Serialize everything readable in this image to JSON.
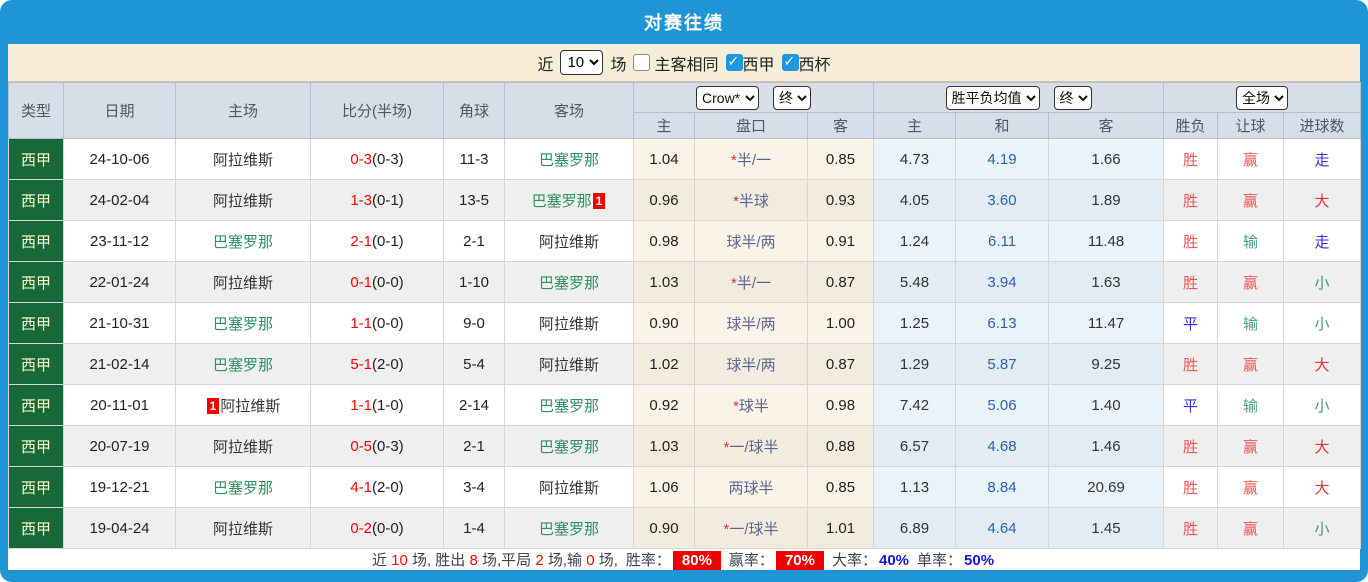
{
  "title": "对赛往绩",
  "filter_bar": {
    "recent_label": "近",
    "recent_select_value": "10",
    "matches_label": "场",
    "checkboxes": [
      {
        "label": "主客相同",
        "checked": false
      },
      {
        "label": "西甲",
        "checked": true
      },
      {
        "label": "西杯",
        "checked": true
      }
    ]
  },
  "table": {
    "base_headers": [
      "类型",
      "日期",
      "主场",
      "比分(半场)",
      "角球",
      "客场"
    ],
    "odds_group": {
      "bookmaker_select": "Crow*",
      "time_select": "终",
      "headers": [
        "主",
        "盘口",
        "客"
      ]
    },
    "avg_group": {
      "type_select": "胜平负均值",
      "time_select": "终",
      "headers": [
        "主",
        "和",
        "客"
      ]
    },
    "result_group": {
      "scope_select": "全场",
      "headers": [
        "胜负",
        "让球",
        "进球数"
      ]
    },
    "rows": [
      {
        "league": "西甲",
        "date": "24-10-06",
        "home": "阿拉维斯",
        "home_green": false,
        "home_badge": "",
        "score": "0-3",
        "half": "(0-3)",
        "corners": "11-3",
        "away": "巴塞罗那",
        "away_green": true,
        "away_badge": "",
        "odds": [
          "1.04",
          "*半/一",
          "0.85"
        ],
        "avg": [
          "4.73",
          "4.19",
          "1.66"
        ],
        "results": [
          [
            "胜",
            "red"
          ],
          [
            "赢",
            "red"
          ],
          [
            "走",
            "blue"
          ]
        ]
      },
      {
        "league": "西甲",
        "date": "24-02-04",
        "home": "阿拉维斯",
        "home_green": false,
        "home_badge": "",
        "score": "1-3",
        "half": "(0-1)",
        "corners": "13-5",
        "away": "巴塞罗那",
        "away_green": true,
        "away_badge": "1",
        "odds": [
          "0.96",
          "*半球",
          "0.93"
        ],
        "avg": [
          "4.05",
          "3.60",
          "1.89"
        ],
        "results": [
          [
            "胜",
            "red"
          ],
          [
            "赢",
            "red"
          ],
          [
            "大",
            "dark_red"
          ]
        ]
      },
      {
        "league": "西甲",
        "date": "23-11-12",
        "home": "巴塞罗那",
        "home_green": true,
        "home_badge": "",
        "score": "2-1",
        "half": "(0-1)",
        "corners": "2-1",
        "away": "阿拉维斯",
        "away_green": false,
        "away_badge": "",
        "odds": [
          "0.98",
          "球半/两",
          "0.91"
        ],
        "avg": [
          "1.24",
          "6.11",
          "11.48"
        ],
        "results": [
          [
            "胜",
            "red"
          ],
          [
            "输",
            "teal"
          ],
          [
            "走",
            "blue"
          ]
        ]
      },
      {
        "league": "西甲",
        "date": "22-01-24",
        "home": "阿拉维斯",
        "home_green": false,
        "home_badge": "",
        "score": "0-1",
        "half": "(0-0)",
        "corners": "1-10",
        "away": "巴塞罗那",
        "away_green": true,
        "away_badge": "",
        "odds": [
          "1.03",
          "*半/一",
          "0.87"
        ],
        "avg": [
          "5.48",
          "3.94",
          "1.63"
        ],
        "results": [
          [
            "胜",
            "red"
          ],
          [
            "赢",
            "red"
          ],
          [
            "小",
            "green"
          ]
        ]
      },
      {
        "league": "西甲",
        "date": "21-10-31",
        "home": "巴塞罗那",
        "home_green": true,
        "home_badge": "",
        "score": "1-1",
        "half": "(0-0)",
        "corners": "9-0",
        "away": "阿拉维斯",
        "away_green": false,
        "away_badge": "",
        "odds": [
          "0.90",
          "球半/两",
          "1.00"
        ],
        "avg": [
          "1.25",
          "6.13",
          "11.47"
        ],
        "results": [
          [
            "平",
            "blue"
          ],
          [
            "输",
            "teal"
          ],
          [
            "小",
            "green"
          ]
        ]
      },
      {
        "league": "西甲",
        "date": "21-02-14",
        "home": "巴塞罗那",
        "home_green": true,
        "home_badge": "",
        "score": "5-1",
        "half": "(2-0)",
        "corners": "5-4",
        "away": "阿拉维斯",
        "away_green": false,
        "away_badge": "",
        "odds": [
          "1.02",
          "球半/两",
          "0.87"
        ],
        "avg": [
          "1.29",
          "5.87",
          "9.25"
        ],
        "results": [
          [
            "胜",
            "red"
          ],
          [
            "赢",
            "red"
          ],
          [
            "大",
            "dark_red"
          ]
        ]
      },
      {
        "league": "西甲",
        "date": "20-11-01",
        "home": "阿拉维斯",
        "home_green": false,
        "home_badge": "1",
        "score": "1-1",
        "half": "(1-0)",
        "corners": "2-14",
        "away": "巴塞罗那",
        "away_green": true,
        "away_badge": "",
        "odds": [
          "0.92",
          "*球半",
          "0.98"
        ],
        "avg": [
          "7.42",
          "5.06",
          "1.40"
        ],
        "results": [
          [
            "平",
            "blue"
          ],
          [
            "输",
            "teal"
          ],
          [
            "小",
            "green"
          ]
        ]
      },
      {
        "league": "西甲",
        "date": "20-07-19",
        "home": "阿拉维斯",
        "home_green": false,
        "home_badge": "",
        "score": "0-5",
        "half": "(0-3)",
        "corners": "2-1",
        "away": "巴塞罗那",
        "away_green": true,
        "away_badge": "",
        "odds": [
          "1.03",
          "*一/球半",
          "0.88"
        ],
        "avg": [
          "6.57",
          "4.68",
          "1.46"
        ],
        "results": [
          [
            "胜",
            "red"
          ],
          [
            "赢",
            "red"
          ],
          [
            "大",
            "dark_red"
          ]
        ]
      },
      {
        "league": "西甲",
        "date": "19-12-21",
        "home": "巴塞罗那",
        "home_green": true,
        "home_badge": "",
        "score": "4-1",
        "half": "(2-0)",
        "corners": "3-4",
        "away": "阿拉维斯",
        "away_green": false,
        "away_badge": "",
        "odds": [
          "1.06",
          "两球半",
          "0.85"
        ],
        "avg": [
          "1.13",
          "8.84",
          "20.69"
        ],
        "results": [
          [
            "胜",
            "red"
          ],
          [
            "赢",
            "red"
          ],
          [
            "大",
            "dark_red"
          ]
        ]
      },
      {
        "league": "西甲",
        "date": "19-04-24",
        "home": "阿拉维斯",
        "home_green": false,
        "home_badge": "",
        "score": "0-2",
        "half": "(0-0)",
        "corners": "1-4",
        "away": "巴塞罗那",
        "away_green": true,
        "away_badge": "",
        "odds": [
          "0.90",
          "*一/球半",
          "1.01"
        ],
        "avg": [
          "6.89",
          "4.64",
          "1.45"
        ],
        "results": [
          [
            "胜",
            "red"
          ],
          [
            "赢",
            "red"
          ],
          [
            "小",
            "green"
          ]
        ]
      }
    ]
  },
  "summary": {
    "prefix": [
      [
        "近 ",
        "d"
      ],
      [
        "10",
        "r"
      ],
      [
        " 场, 胜出 ",
        "d"
      ],
      [
        "8",
        "r"
      ],
      [
        " 场,平局 ",
        "d"
      ],
      [
        "2",
        "r"
      ],
      [
        " 场,输 ",
        "d"
      ],
      [
        "0",
        "r"
      ],
      [
        " 场, ",
        "d"
      ]
    ],
    "rates": [
      {
        "label": "胜率：",
        "value": "80%",
        "style": "badge"
      },
      {
        "label": "赢率：",
        "value": "70%",
        "style": "badge"
      },
      {
        "label": "大率：",
        "value": "40%",
        "style": "blue"
      },
      {
        "label": "单率：",
        "value": "50%",
        "style": "blue"
      }
    ]
  },
  "colors": {
    "header_blue": "#2095d6",
    "filter_bg": "#f8eed8",
    "table_header_bg": "#d7dee8",
    "type_cell_green": "#17693a",
    "type_cell_text": "#ffffc8",
    "team_green": "#2e9160",
    "score_red": "#fe0000",
    "handicap_slate": "#5b6690",
    "handicap_star_red": "#e03030",
    "odds_bg": "#faf4e8",
    "avg_bg": "#eaf3f9",
    "avg_draw_blue": "#2b62b0",
    "result_red": "#f25555",
    "result_dark_red": "#e43333",
    "result_blue": "#3030dd",
    "result_green": "#3f9e6a",
    "result_teal": "#4a9e88",
    "badge_red": "#f20000",
    "rate_value_blue": "#1515dd"
  }
}
